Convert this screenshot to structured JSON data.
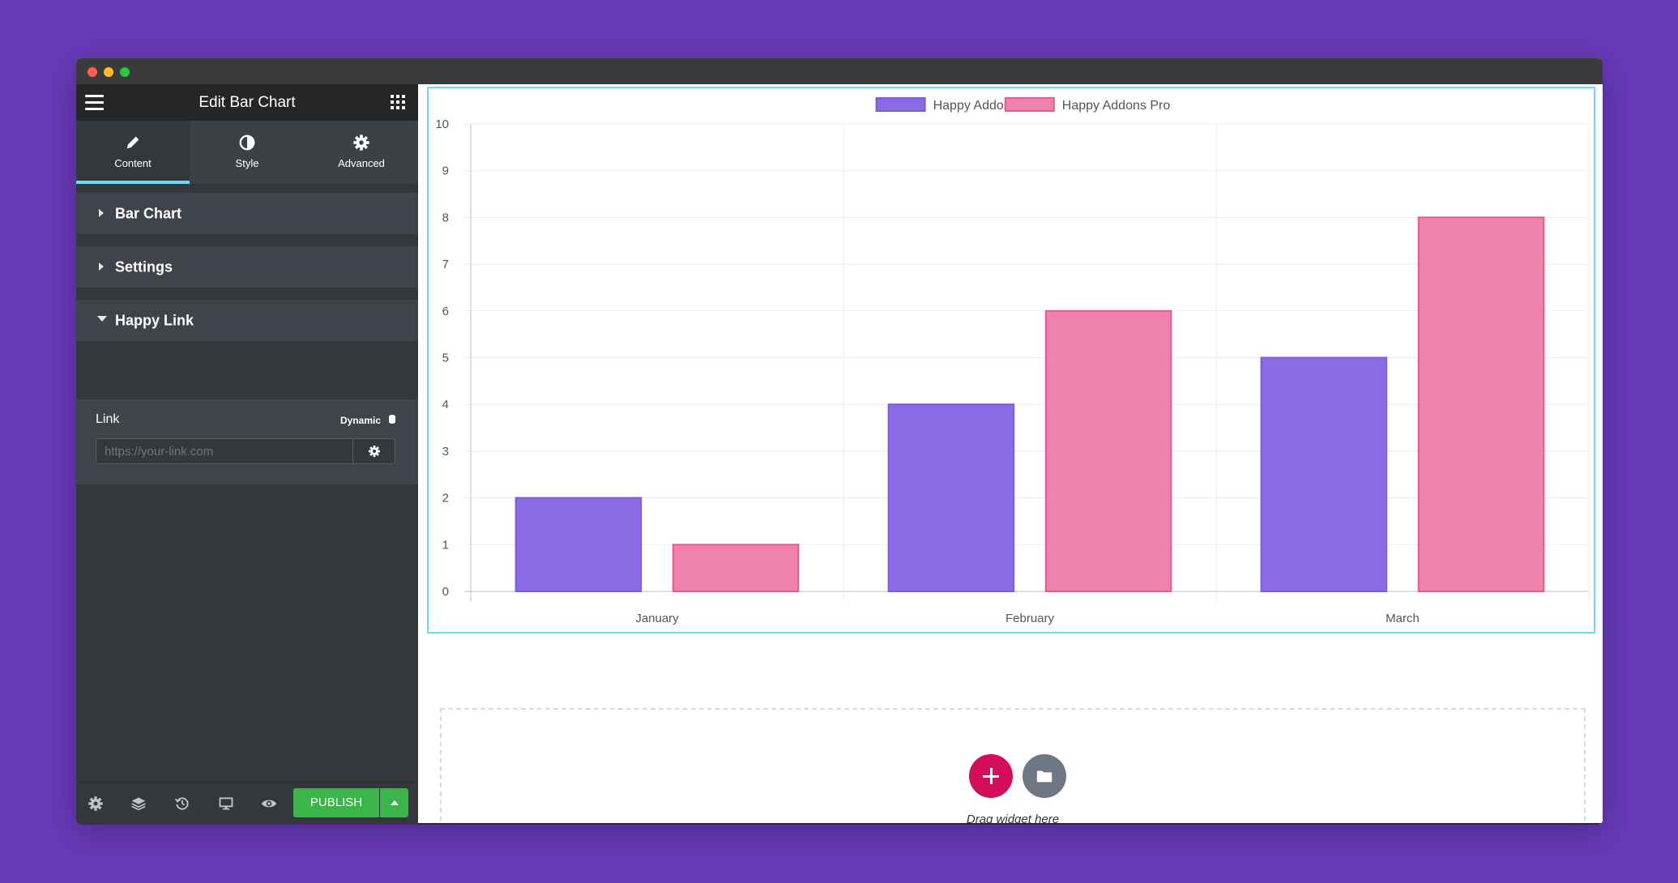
{
  "panel": {
    "title": "Edit Bar Chart",
    "tabs": [
      {
        "label": "Content",
        "icon": "pencil-icon",
        "active": true
      },
      {
        "label": "Style",
        "icon": "half-circle-icon",
        "active": false
      },
      {
        "label": "Advanced",
        "icon": "gear-icon",
        "active": false
      }
    ],
    "sections": [
      {
        "label": "Bar Chart",
        "expanded": false
      },
      {
        "label": "Settings",
        "expanded": false
      },
      {
        "label": "Happy Link",
        "expanded": true
      }
    ],
    "link": {
      "label": "Link",
      "dynamic_label": "Dynamic",
      "placeholder": "https://your-link.com",
      "value": ""
    },
    "footer": {
      "publish_label": "PUBLISH",
      "icons": [
        "settings-icon",
        "layers-icon",
        "history-icon",
        "responsive-icon",
        "preview-icon"
      ]
    }
  },
  "colors": {
    "accent": "#71d7f7",
    "publish": "#39b54a",
    "series1_fill": "#8a6be3",
    "series1_stroke": "#7b5cd9",
    "series2_fill": "#ee82ad",
    "series2_stroke": "#e05b93",
    "page_bg": "#673ab7",
    "add_button": "#d30c5c"
  },
  "chart_data": {
    "type": "bar",
    "categories": [
      "January",
      "February",
      "March"
    ],
    "series": [
      {
        "name": "Happy Addons",
        "values": [
          2,
          4,
          5
        ]
      },
      {
        "name": "Happy Addons Pro",
        "values": [
          1,
          6,
          8
        ]
      }
    ],
    "ylim": [
      0,
      10
    ],
    "yticks": [
      0,
      1,
      2,
      3,
      4,
      5,
      6,
      7,
      8,
      9,
      10
    ],
    "grid": true,
    "legend": "top-center",
    "title": "",
    "xlabel": "",
    "ylabel": ""
  },
  "dropzone": {
    "text": "Drag widget here"
  }
}
